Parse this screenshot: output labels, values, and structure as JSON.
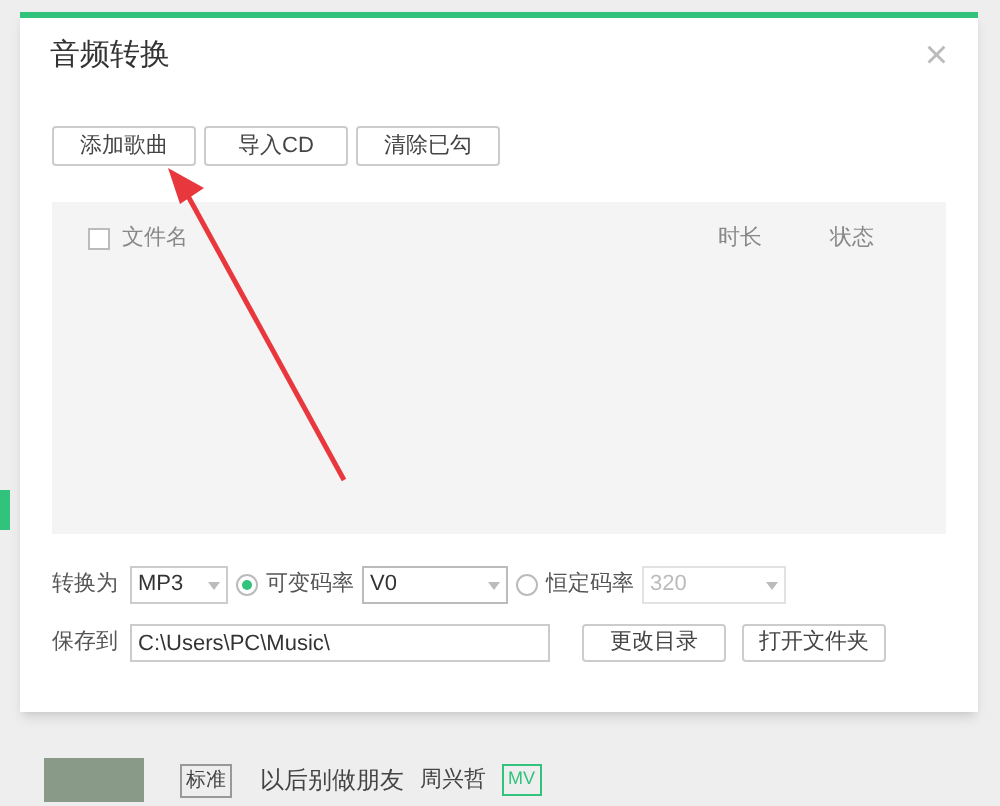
{
  "dialog": {
    "title": "音频转换",
    "close": "×",
    "toolbar": [
      "添加歌曲",
      "导入CD",
      "清除已勾"
    ],
    "list": {
      "select_all": {
        "checked": false
      },
      "columns": [
        "文件名",
        "时长",
        "状态"
      ]
    },
    "convert": {
      "label": "转换为",
      "format": "MP3",
      "modes": [
        {
          "label": "可变码率",
          "selected": true,
          "value": "V0"
        },
        {
          "label": "恒定码率",
          "selected": false,
          "value": "320"
        }
      ]
    },
    "save": {
      "label": "保存到",
      "path": "C:\\Users\\PC\\Music\\",
      "buttons": [
        "更改目录",
        "打开文件夹"
      ]
    }
  },
  "background_row": {
    "quality": "标准",
    "song": "以后别做朋友",
    "artist": "周兴哲",
    "badge": "MV"
  }
}
